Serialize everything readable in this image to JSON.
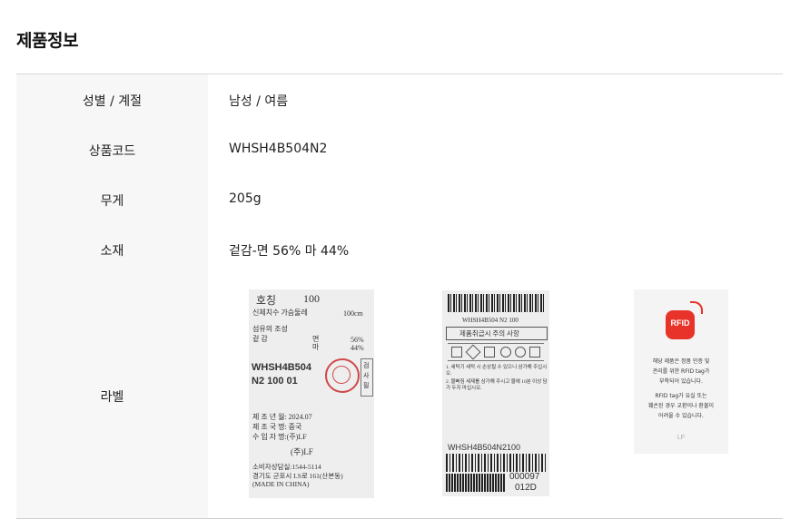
{
  "section": {
    "title": "제품정보"
  },
  "rows": [
    {
      "label": "성별 / 계절",
      "value": "남성 / 여름"
    },
    {
      "label": "상품코드",
      "value": "WHSH4B504N2"
    },
    {
      "label": "무게",
      "value": "205g"
    },
    {
      "label": "소재",
      "value": "겉감-면 56% 마 44%"
    },
    {
      "label": "라벨"
    }
  ],
  "label1": {
    "size_title": "호칭",
    "size_value": "100",
    "chest_label": "신체치수 가슴둘레",
    "chest_value": "100cm",
    "fiber_title": "섬유의 조성",
    "shell_label": "겉 감",
    "fiber1": "면",
    "fiber1_pct": "56%",
    "fiber2": "마",
    "fiber2_pct": "44%",
    "code1": "WHSH4B504",
    "code2": "N2 100 01",
    "stamp_side": "검사필",
    "mfg_date": "제 조 년 월: 2024.07",
    "origin": "제 조 국 명: 중국",
    "importer": "수 입 자 명:(주)LF",
    "brand": "(주)LF",
    "phone": "소비자상담실:1544-5114",
    "address": "경기도 군포시 LS로 161(산본동)",
    "made_in": "(MADE IN CHINA)"
  },
  "label2": {
    "code_top": "WHSH4B504 N2 100",
    "care_title": "제품취급시 주의 사항",
    "note1": "1. 세탁기 세탁 시 손상될 수 있으니 삼가해 주십시오.",
    "note2": "2. 물빠짐 세제를 삼가해 주시고 물에 10분 이상 담가 두지 마십시오.",
    "code_bottom": "WHSH4B504N2100",
    "serial1": "000097",
    "serial2": "012D"
  },
  "label3": {
    "rfid_text": "RFID",
    "line1": "해당 제품은 정품 인증 및",
    "line2": "관리를 위한 RFID tag가",
    "line3": "부착되어 있습니다.",
    "line4": "RFID tag가 유실 또는",
    "line5": "훼손된 경우 교환이나 환불이",
    "line6": "어려울 수 있습니다.",
    "logo": "LF",
    "accent": "#e8332a"
  }
}
